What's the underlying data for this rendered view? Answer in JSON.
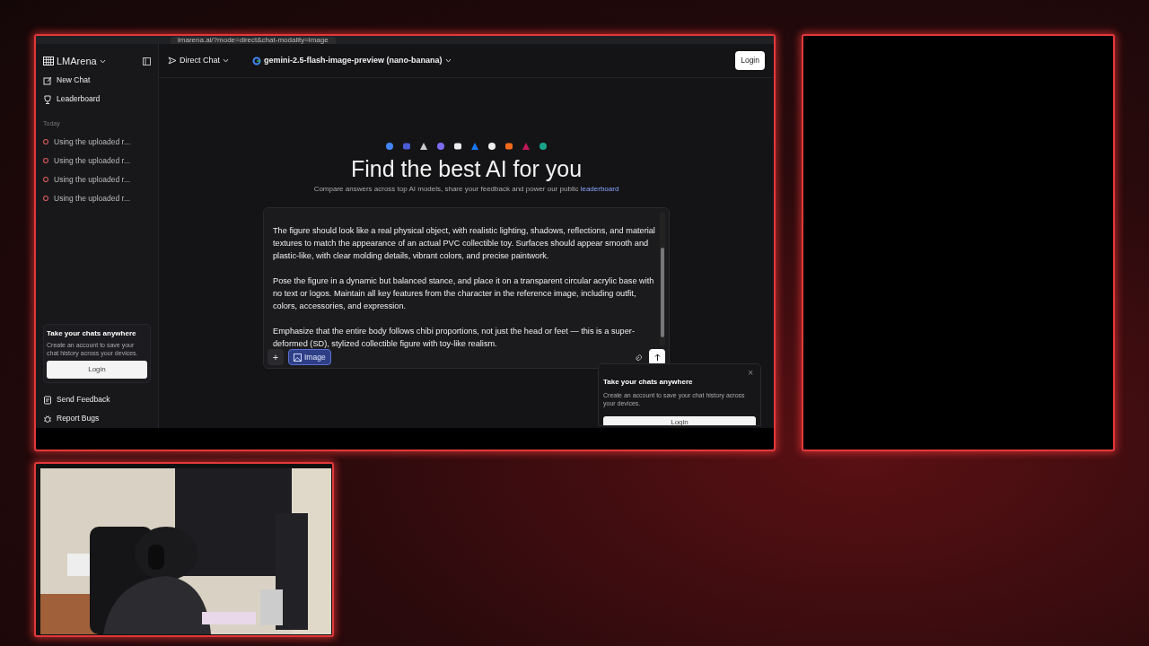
{
  "browser": {
    "url": "lmarena.ai/?mode=direct&chat-modality=image"
  },
  "sidebar": {
    "brand": "LMArena",
    "nav": [
      {
        "label": "New Chat",
        "kind": "edit"
      },
      {
        "label": "Leaderboard",
        "kind": "trophy"
      }
    ],
    "section": "Today",
    "history": [
      {
        "label": "Using the uploaded r..."
      },
      {
        "label": "Using the uploaded r..."
      },
      {
        "label": "Using the uploaded r..."
      },
      {
        "label": "Using the uploaded r..."
      }
    ],
    "promo": {
      "title": "Take your chats anywhere",
      "text": "Create an account to save your chat history across your devices.",
      "button": "Login"
    },
    "footer": [
      {
        "label": "Send Feedback",
        "kind": "feedback"
      },
      {
        "label": "Report Bugs",
        "kind": "bug"
      }
    ]
  },
  "header": {
    "mode": "Direct Chat",
    "model": "gemini-2.5-flash-image-preview (nano-banana)",
    "login": "Login"
  },
  "hero": {
    "title": "Find the best AI for you",
    "subtitle": "Compare answers across top AI models, share your feedback and power our public",
    "link": "leaderboard"
  },
  "composer": {
    "paragraphs": [
      "The figure should look like a real physical object, with realistic lighting, shadows, reflections, and material textures to match the appearance of an actual PVC collectible toy. Surfaces should appear smooth and plastic-like, with clear molding details, vibrant colors, and precise paintwork.",
      "Pose the figure in a dynamic but balanced stance, and place it on a transparent circular acrylic base with no text or logos. Maintain all key features from the character in the reference image, including outfit, colors, accessories, and expression.",
      "Emphasize that the entire body follows chibi proportions, not just the head or feet — this is a super-deformed (SD), stylized collectible figure with toy-like realism."
    ],
    "add": "+",
    "chip": {
      "label": "Image",
      "selected": true
    }
  },
  "toast": {
    "title": "Take your chats anywhere",
    "text": "Create an account to save your chat history across your devices.",
    "button": "Login",
    "close": "×"
  }
}
